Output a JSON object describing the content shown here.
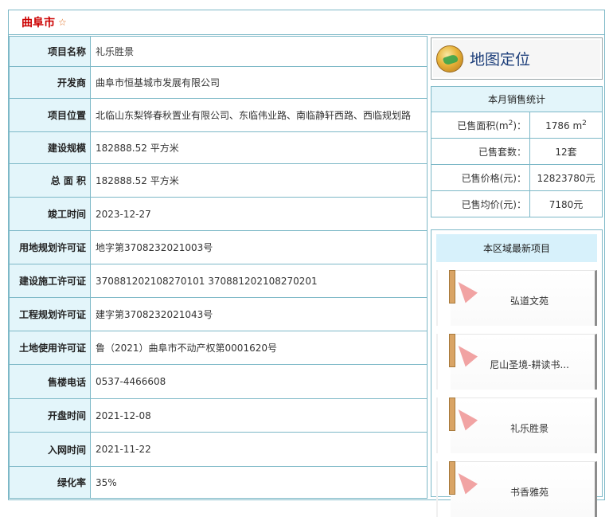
{
  "header": {
    "city": "曲阜市",
    "star": "☆"
  },
  "info_rows": [
    {
      "label": "项目名称",
      "value": "礼乐胜景"
    },
    {
      "label": "开发商",
      "value": "曲阜市恒基城市发展有限公司"
    },
    {
      "label": "项目位置",
      "value": "北临山东梨铧春秋置业有限公司、东临伟业路、南临静轩西路、西临规划路"
    },
    {
      "label": "建设规模",
      "value": "182888.52 平方米"
    },
    {
      "label": "总 面 积",
      "value": "182888.52 平方米"
    },
    {
      "label": "竣工时间",
      "value": "2023-12-27"
    },
    {
      "label": "用地规划许可证",
      "value": "地字第3708232021003号"
    },
    {
      "label": "建设施工许可证",
      "value": "370881202108270101 370881202108270201"
    },
    {
      "label": "工程规划许可证",
      "value": "建字第3708232021043号"
    },
    {
      "label": "土地使用许可证",
      "value": "鲁（2021）曲阜市不动产权第0001620号"
    },
    {
      "label": "售楼电话",
      "value": "0537-4466608"
    },
    {
      "label": "开盘时间",
      "value": "2021-12-08"
    },
    {
      "label": "入网时间",
      "value": "2021-11-22"
    },
    {
      "label": "绿化率",
      "value": "35%"
    }
  ],
  "map": {
    "label": "地图定位",
    "icon": "globe-icon"
  },
  "stats": {
    "title": "本月销售统计",
    "area_label_prefix": "已售面积(m",
    "area_label_suffix": ")：",
    "area_value": "1786 m",
    "exp": "2",
    "count_label": "已售套数：",
    "count_value": "12套",
    "price_label": "已售价格(元)：",
    "price_value": "12823780元",
    "avg_label": "已售均价(元)：",
    "avg_value": "7180元"
  },
  "new_projects": {
    "title": "本区域最新项目",
    "items": [
      {
        "name": "弘道文苑"
      },
      {
        "name": "尼山圣境-耕读书..."
      },
      {
        "name": "礼乐胜景"
      },
      {
        "name": "书香雅苑"
      }
    ]
  },
  "colors": {
    "border": "#7db8c7",
    "label_bg": "#e3f5fa",
    "city": "#cc0000",
    "map_text": "#1c3e7a"
  }
}
